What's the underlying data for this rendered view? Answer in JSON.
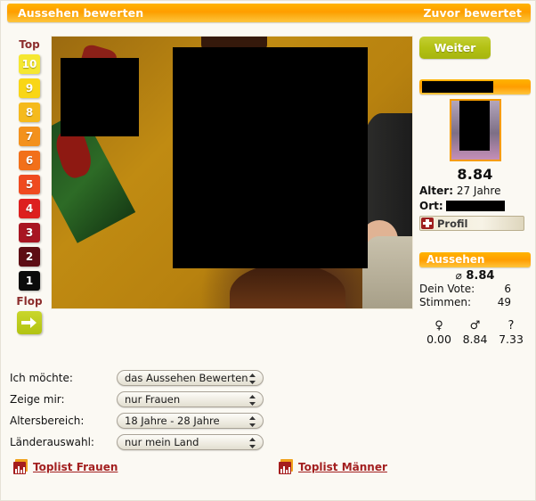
{
  "header": {
    "title": "Aussehen bewerten",
    "right_link": "Zuvor bewertet"
  },
  "rating_rail": {
    "top_label": "Top",
    "flop_label": "Flop",
    "buttons": [
      {
        "value": "10",
        "color": "#f5e731"
      },
      {
        "value": "9",
        "color": "#f9d616"
      },
      {
        "value": "8",
        "color": "#f5ba1d"
      },
      {
        "value": "7",
        "color": "#f3911d"
      },
      {
        "value": "6",
        "color": "#f2701a"
      },
      {
        "value": "5",
        "color": "#ef4a20"
      },
      {
        "value": "4",
        "color": "#dd1f1f"
      },
      {
        "value": "3",
        "color": "#a81522"
      },
      {
        "value": "2",
        "color": "#5d0d14"
      },
      {
        "value": "1",
        "color": "#0b0b0b"
      }
    ],
    "next_arrow_icon": "arrow-right-icon"
  },
  "photo": {
    "icon": "rated-photo",
    "redactions": 2
  },
  "profile_panel": {
    "next_button": "Weiter",
    "name_redacted": true,
    "thumbnail_icon": "profile-thumbnail",
    "score": "8.84",
    "age_label": "Alter:",
    "age_value": "27 Jahre",
    "location_label": "Ort:",
    "location_value_redacted": true,
    "profile_button": "Profil",
    "profile_button_icon": "profile-badge-icon"
  },
  "looks_panel": {
    "title": "Aussehen",
    "average_symbol": "⌀",
    "average_value": "8.84",
    "rows": [
      {
        "label": "Dein Vote:",
        "value": "6"
      },
      {
        "label": "Stimmen:",
        "value": "49"
      }
    ],
    "gender_stats": [
      {
        "symbol": "♀",
        "icon": "female-icon",
        "value": "0.00"
      },
      {
        "symbol": "♂",
        "icon": "male-icon",
        "value": "8.84"
      },
      {
        "symbol": "?",
        "icon": "unknown-gender-icon",
        "value": "7.33"
      }
    ]
  },
  "filters": [
    {
      "label": "Ich möchte:",
      "value": "das Aussehen Bewerten"
    },
    {
      "label": "Zeige mir:",
      "value": "nur Frauen"
    },
    {
      "label": "Altersbereich:",
      "value": "18 Jahre - 28 Jahre"
    },
    {
      "label": "Länderauswahl:",
      "value": "nur mein Land"
    }
  ],
  "toplists": [
    {
      "label": "Toplist Frauen",
      "icon": "bar-chart-icon"
    },
    {
      "label": "Toplist Männer",
      "icon": "bar-chart-icon"
    }
  ]
}
